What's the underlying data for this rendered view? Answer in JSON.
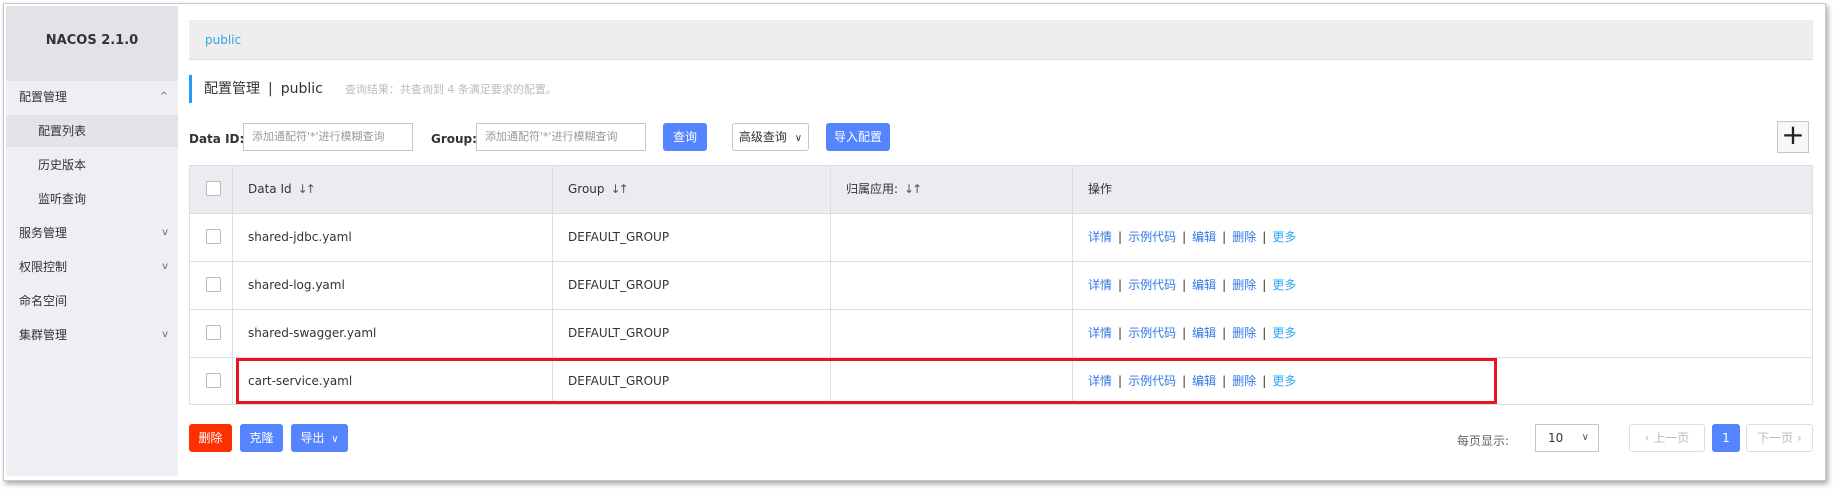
{
  "sidebar": {
    "title": "NACOS 2.1.0",
    "items": [
      {
        "label": "配置管理",
        "chevron": "^"
      },
      {
        "label": "配置列表"
      },
      {
        "label": "历史版本"
      },
      {
        "label": "监听查询"
      },
      {
        "label": "服务管理",
        "chevron": "v"
      },
      {
        "label": "权限控制",
        "chevron": "v"
      },
      {
        "label": "命名空间"
      },
      {
        "label": "集群管理",
        "chevron": "v"
      }
    ]
  },
  "breadcrumb": {
    "namespace": "public"
  },
  "header": {
    "title": "配置管理",
    "separator": "|",
    "namespace": "public",
    "result_hint": "查询结果：共查询到 4 条满足要求的配置。"
  },
  "search": {
    "dataid_label": "Data ID:",
    "dataid_placeholder": "添加通配符'*'进行模糊查询",
    "group_label": "Group:",
    "group_placeholder": "添加通配符'*'进行模糊查询",
    "query_button": "查询",
    "advanced_button": "高级查询",
    "import_button": "导入配置"
  },
  "table": {
    "columns": [
      "Data Id",
      "Group",
      "归属应用:",
      "操作"
    ],
    "rows": [
      {
        "data_id": "shared-jdbc.yaml",
        "group": "DEFAULT_GROUP",
        "app": ""
      },
      {
        "data_id": "shared-log.yaml",
        "group": "DEFAULT_GROUP",
        "app": ""
      },
      {
        "data_id": "shared-swagger.yaml",
        "group": "DEFAULT_GROUP",
        "app": ""
      },
      {
        "data_id": "cart-service.yaml",
        "group": "DEFAULT_GROUP",
        "app": ""
      }
    ],
    "actions": {
      "detail": "详情",
      "sample": "示例代码",
      "edit": "编辑",
      "delete": "删除",
      "more": "更多"
    }
  },
  "footer": {
    "delete_button": "删除",
    "clone_button": "克隆",
    "export_button": "导出",
    "page_size_label": "每页显示:",
    "page_size": "10",
    "prev_button": "上一页",
    "current_page": "1",
    "next_button": "下一页"
  },
  "colors": {
    "primary": "#5584ff",
    "danger": "#ff3000",
    "link": "#2f79e6",
    "highlight": "#e8141e"
  }
}
